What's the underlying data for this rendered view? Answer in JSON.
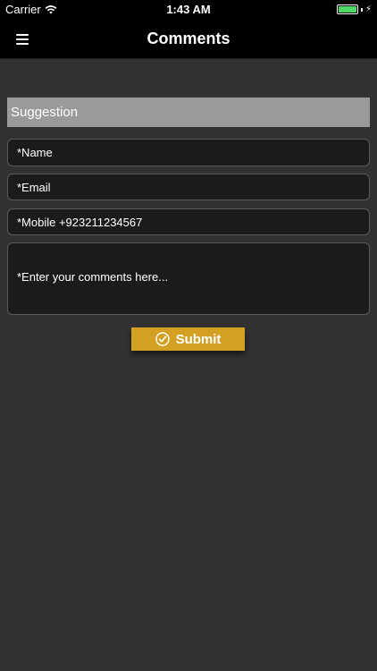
{
  "status_bar": {
    "carrier": "Carrier",
    "time": "1:43 AM",
    "battery_level": 1.0,
    "battery_color": "#4cd964"
  },
  "nav": {
    "title": "Comments",
    "menu_icon": "hamburger-menu-icon"
  },
  "form": {
    "section_header": "Suggestion",
    "name_placeholder": "*Name",
    "email_placeholder": "*Email",
    "mobile_placeholder": "*Mobile +923211234567",
    "comments_placeholder": "*Enter your comments here...",
    "submit_label": "Submit",
    "submit_icon": "check-circle-icon",
    "accent_color": "#d4a024"
  }
}
